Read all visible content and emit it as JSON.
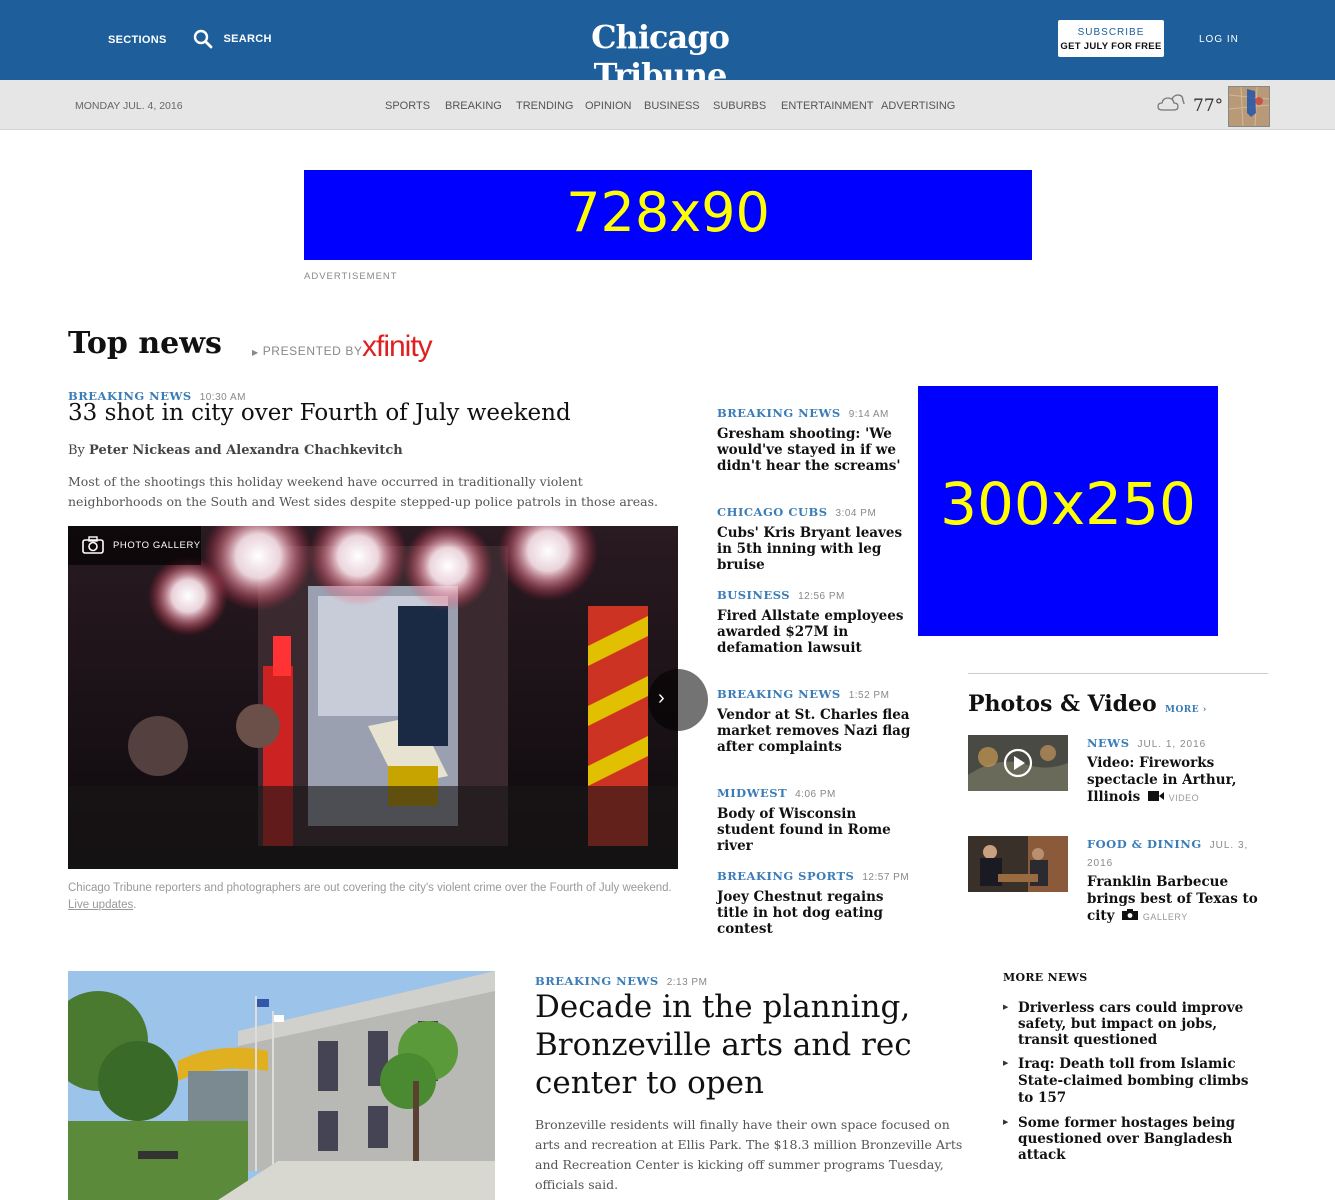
{
  "header": {
    "sections_label": "SECTIONS",
    "search_label": "SEARCH",
    "logo_text": "Chicago Tribune",
    "subscribe_line1": "SUBSCRIBE",
    "subscribe_line2": "GET JULY FOR FREE",
    "login_label": "LOG IN"
  },
  "subnav": {
    "date": "MONDAY JUL. 4, 2016",
    "items": [
      "SPORTS",
      "BREAKING",
      "TRENDING",
      "OPINION",
      "BUSINESS",
      "SUBURBS",
      "ENTERTAINMENT",
      "ADVERTISING"
    ],
    "temperature": "77°"
  },
  "ads": {
    "leaderboard": "728x90",
    "leaderboard_label": "ADVERTISEMENT",
    "box": "300x250"
  },
  "top_news": {
    "title": "Top news",
    "presented_by": "PRESENTED BY",
    "sponsor": "xfinity",
    "lead": {
      "kicker": "BREAKING NEWS",
      "time": "10:30 AM",
      "headline": "33 shot in city over Fourth of July weekend",
      "byline_prefix": "By",
      "byline": "Peter Nickeas and Alexandra Chachkevitch",
      "summary": "Most of the shootings this holiday weekend have occurred in traditionally violent neighborhoods on the South and West sides despite stepped-up police patrols in those areas.",
      "gallery_label": "PHOTO GALLERY",
      "caption": "Chicago Tribune reporters and photographers are out covering the city's violent crime over the Fourth of July weekend.",
      "caption_link": "Live updates",
      "caption_end": "."
    },
    "stories": [
      {
        "kicker": "BREAKING NEWS",
        "time": "9:14 AM",
        "headline": "Gresham shooting: 'We would've stayed in if we didn't hear the screams'"
      },
      {
        "kicker": "CHICAGO CUBS",
        "time": "3:04 PM",
        "headline": "Cubs' Kris Bryant leaves in 5th inning with leg bruise"
      },
      {
        "kicker": "BUSINESS",
        "time": "12:56 PM",
        "headline": "Fired Allstate employees awarded $27M in defamation lawsuit"
      },
      {
        "kicker": "BREAKING NEWS",
        "time": "1:52 PM",
        "headline": "Vendor at St. Charles flea market removes Nazi flag after complaints"
      },
      {
        "kicker": "MIDWEST",
        "time": "4:06 PM",
        "headline": "Body of Wisconsin student found in Rome river"
      },
      {
        "kicker": "BREAKING SPORTS",
        "time": "12:57 PM",
        "headline": "Joey Chestnut regains title in hot dog eating contest"
      }
    ]
  },
  "photos_video": {
    "title": "Photos & Video",
    "more_label": "MORE ›",
    "items": [
      {
        "kicker": "NEWS",
        "date": "JUL. 1, 2016",
        "headline": "Video: Fireworks spectacle in Arthur, Illinois",
        "media_label": "VIDEO"
      },
      {
        "kicker": "FOOD & DINING",
        "date": "JUL. 3, 2016",
        "headline": "Franklin Barbecue brings best of Texas to city",
        "media_label": "GALLERY"
      }
    ]
  },
  "second": {
    "kicker": "BREAKING NEWS",
    "time": "2:13 PM",
    "headline": "Decade in the planning, Bronzeville arts and rec center to open",
    "summary": "Bronzeville residents will finally have their own space focused on arts and recreation at Ellis Park. The $18.3 million Bronzeville Arts and Recreation Center is kicking off summer programs Tuesday, officials said."
  },
  "more_news": {
    "title": "MORE NEWS",
    "items": [
      "Driverless cars could improve safety, but impact on jobs, transit questioned",
      "Iraq: Death toll from Islamic State-claimed bombing climbs to 157",
      "Some former hostages being questioned over Bangladesh attack"
    ]
  }
}
